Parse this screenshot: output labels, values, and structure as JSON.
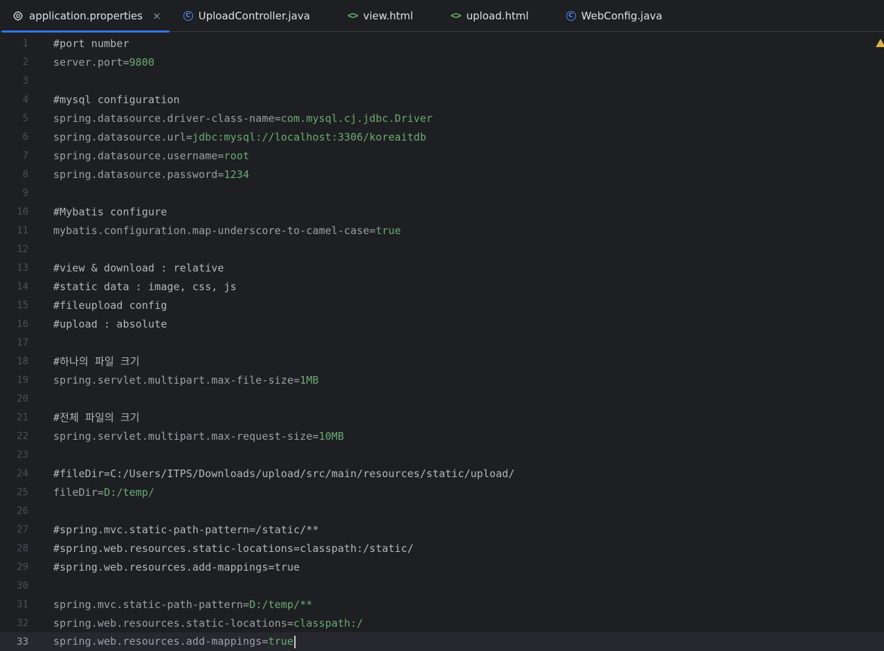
{
  "tabs": [
    {
      "label": "application.properties",
      "icon": "gear-icon",
      "active": true,
      "closable": true
    },
    {
      "label": "UploadController.java",
      "icon": "class-c-icon"
    },
    {
      "label": "view.html",
      "icon": "html-icon"
    },
    {
      "label": "upload.html",
      "icon": "html-icon"
    },
    {
      "label": "WebConfig.java",
      "icon": "class-c-icon"
    }
  ],
  "close_glyph": "×",
  "current_line": 33,
  "lines": [
    {
      "num": "1",
      "type": "comment",
      "text": "#port number"
    },
    {
      "num": "2",
      "type": "kv",
      "key": "server.port",
      "value": "9800"
    },
    {
      "num": "3",
      "type": "blank"
    },
    {
      "num": "4",
      "type": "comment",
      "text": "#mysql configuration"
    },
    {
      "num": "5",
      "type": "kv",
      "key": "spring.datasource.driver-class-name",
      "value": "com.mysql.cj.jdbc.Driver"
    },
    {
      "num": "6",
      "type": "kv",
      "key": "spring.datasource.url",
      "value": "jdbc:mysql://localhost:3306/koreaitdb"
    },
    {
      "num": "7",
      "type": "kv",
      "key": "spring.datasource.username",
      "value": "root"
    },
    {
      "num": "8",
      "type": "kv",
      "key": "spring.datasource.password",
      "value": "1234"
    },
    {
      "num": "9",
      "type": "blank"
    },
    {
      "num": "10",
      "type": "comment",
      "text": "#Mybatis configure"
    },
    {
      "num": "11",
      "type": "kv",
      "key": "mybatis.configuration.map-underscore-to-camel-case",
      "value": "true"
    },
    {
      "num": "12",
      "type": "blank"
    },
    {
      "num": "13",
      "type": "comment",
      "text": "#view & download : relative"
    },
    {
      "num": "14",
      "type": "comment",
      "text": "#static data : image, css, js"
    },
    {
      "num": "15",
      "type": "comment",
      "text": "#fileupload config"
    },
    {
      "num": "16",
      "type": "comment",
      "text": "#upload : absolute"
    },
    {
      "num": "17",
      "type": "blank"
    },
    {
      "num": "18",
      "type": "comment",
      "text": "#하나의 파일 크기"
    },
    {
      "num": "19",
      "type": "kv",
      "key": "spring.servlet.multipart.max-file-size",
      "value": "1MB"
    },
    {
      "num": "20",
      "type": "blank"
    },
    {
      "num": "21",
      "type": "comment",
      "text": "#전체 파일의 크기"
    },
    {
      "num": "22",
      "type": "kv",
      "key": "spring.servlet.multipart.max-request-size",
      "value": "10MB"
    },
    {
      "num": "23",
      "type": "blank"
    },
    {
      "num": "24",
      "type": "comment",
      "text": "#fileDir=C:/Users/ITPS/Downloads/upload/src/main/resources/static/upload/"
    },
    {
      "num": "25",
      "type": "kv",
      "key": "fileDir",
      "value": "D:/temp/"
    },
    {
      "num": "26",
      "type": "blank"
    },
    {
      "num": "27",
      "type": "comment",
      "text": "#spring.mvc.static-path-pattern=/static/**"
    },
    {
      "num": "28",
      "type": "comment",
      "text": "#spring.web.resources.static-locations=classpath:/static/"
    },
    {
      "num": "29",
      "type": "comment",
      "text": "#spring.web.resources.add-mappings=true"
    },
    {
      "num": "30",
      "type": "blank"
    },
    {
      "num": "31",
      "type": "kv",
      "key": "spring.mvc.static-path-pattern",
      "value": "D:/temp/**"
    },
    {
      "num": "32",
      "type": "kv",
      "key": "spring.web.resources.static-locations",
      "value": "classpath:/"
    },
    {
      "num": "33",
      "type": "kv",
      "key": "spring.web.resources.add-mappings",
      "value": "true"
    }
  ],
  "colors": {
    "background": "#1e1f22",
    "tab_active_underline": "#3574f0",
    "value_green": "#6aab73",
    "line_number": "#4b5059",
    "warning": "#e0b248"
  }
}
